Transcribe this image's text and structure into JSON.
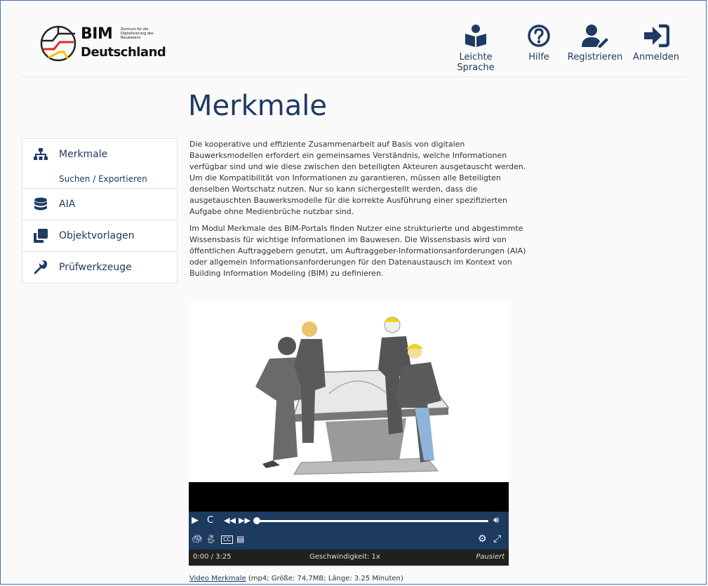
{
  "logo": {
    "big": "BIM",
    "small": "Zentrum für die Digitalisierung des Bauwesens",
    "country": "Deutschland"
  },
  "header": {
    "items": [
      {
        "label": "Leichte Sprache",
        "icon": "book-reader-icon"
      },
      {
        "label": "Hilfe",
        "icon": "question-circle-icon"
      },
      {
        "label": "Registrieren",
        "icon": "user-edit-icon"
      },
      {
        "label": "Anmelden",
        "icon": "sign-in-icon"
      }
    ]
  },
  "sidebar": {
    "items": [
      {
        "label": "Merkmale",
        "icon": "sitemap-icon"
      },
      {
        "label": "Suchen / Exportieren",
        "icon": ""
      },
      {
        "label": "AIA",
        "icon": "database-icon"
      },
      {
        "label": "Objektvorlagen",
        "icon": "clone-icon"
      },
      {
        "label": "Prüfwerkzeuge",
        "icon": "wrench-icon"
      }
    ]
  },
  "main": {
    "title": "Merkmale",
    "paragraphs": [
      "Die kooperative und effiziente Zusammenarbeit auf Basis von digitalen Bauwerksmodellen erfordert ein gemeinsames Verständnis, welche Informationen verfügbar sind und wie diese zwischen den beteiligten Akteuren ausgetauscht werden. Um die Kompatibilität von Informationen zu garantieren, müssen alle Beteiligten denselben Wortschatz nutzen. Nur so kann sichergestellt werden, dass die ausgetauschten Bauwerksmodelle für die korrekte Ausführung einer spezifizierten Aufgabe ohne Medienbrüche nutzbar sind.",
      "Im Modul Merkmale des BIM-Portals finden Nutzer eine strukturierte und abgestimmte Wissensbasis für wichtige Informationen im Bauwesen. Die Wissensbasis wird von öffentlichen Auftraggebern genutzt, um Auftraggeber-Informationsanforderungen (AIA) oder allgemein Informationsanforderungen für den Datenaustausch im Kontext von Building Information Modeling (BIM) zu definieren."
    ]
  },
  "video": {
    "time": "0:00 / 3:25",
    "speed": "Geschwindigkeit: 1x",
    "state": "Pausiert",
    "progress": 0,
    "link_text": "Video Merkmale",
    "link_meta": " (mp4; Größe: 74,7MB; Länge: 3.25 Minuten)"
  },
  "colors": {
    "brand": "#1f3a64",
    "control_bar": "#1d3a5f"
  }
}
